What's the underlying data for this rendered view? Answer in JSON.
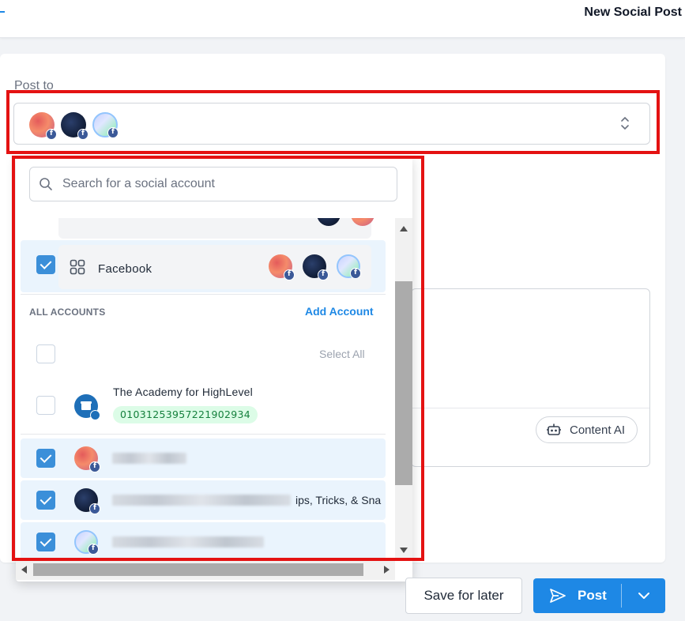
{
  "header": {
    "title": "New Social Post"
  },
  "post_to": {
    "label": "Post to"
  },
  "search": {
    "placeholder": "Search for a social account"
  },
  "groups": [
    {
      "label": "Facebook",
      "checked": true
    }
  ],
  "all_accounts": {
    "label": "ALL ACCOUNTS",
    "add_account": "Add Account",
    "select_all": "Select All"
  },
  "accounts": [
    {
      "name": "The Academy for HighLevel",
      "id": "01031253957221902934",
      "checked": false
    },
    {
      "name_tail": "",
      "checked": true
    },
    {
      "name_tail": "ips, Tricks, & Sna",
      "checked": true
    },
    {
      "name_tail": "",
      "checked": true
    }
  ],
  "content_ai": {
    "label": "Content AI"
  },
  "actions": {
    "save_label": "Save for later",
    "post_label": "Post"
  },
  "colors": {
    "primary": "#1e88e5",
    "highlight": "#e41212",
    "facebook": "#3b5998",
    "id_badge": "#dcfce7"
  },
  "icons": [
    "search-icon",
    "grid-icon",
    "facebook-icon",
    "send-icon",
    "chevron-down-icon",
    "robot-icon",
    "pencil-icon",
    "updown-icon"
  ]
}
